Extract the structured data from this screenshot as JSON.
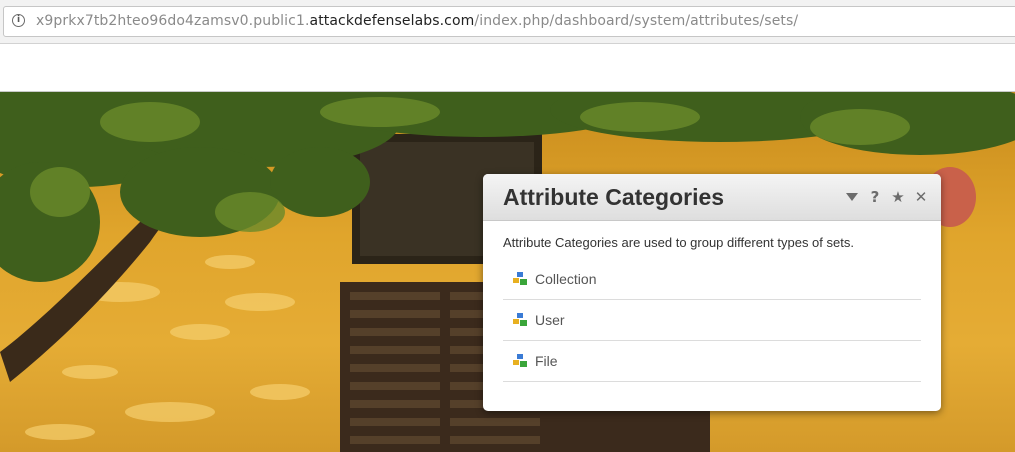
{
  "browser": {
    "url_prefix": "x9prkx7tb2hteo96do4zamsv0.public1.",
    "url_domain": "attackdefenselabs.com",
    "url_path": "/index.php/dashboard/system/attributes/sets/",
    "info_icon": "info-icon"
  },
  "dialog": {
    "title": "Attribute Categories",
    "header_icons": [
      "dropdown-arrow-icon",
      "help-icon",
      "star-icon",
      "close-icon"
    ],
    "description": "Attribute Categories are used to group different types of sets.",
    "categories": [
      {
        "label": "Collection",
        "icon": "category-icon"
      },
      {
        "label": "User",
        "icon": "category-icon"
      },
      {
        "label": "File",
        "icon": "category-icon"
      }
    ]
  },
  "colors": {
    "wall": "#e0a52c",
    "foliage": "#3f5f1c",
    "dialog_header": "#e4e4e4"
  }
}
